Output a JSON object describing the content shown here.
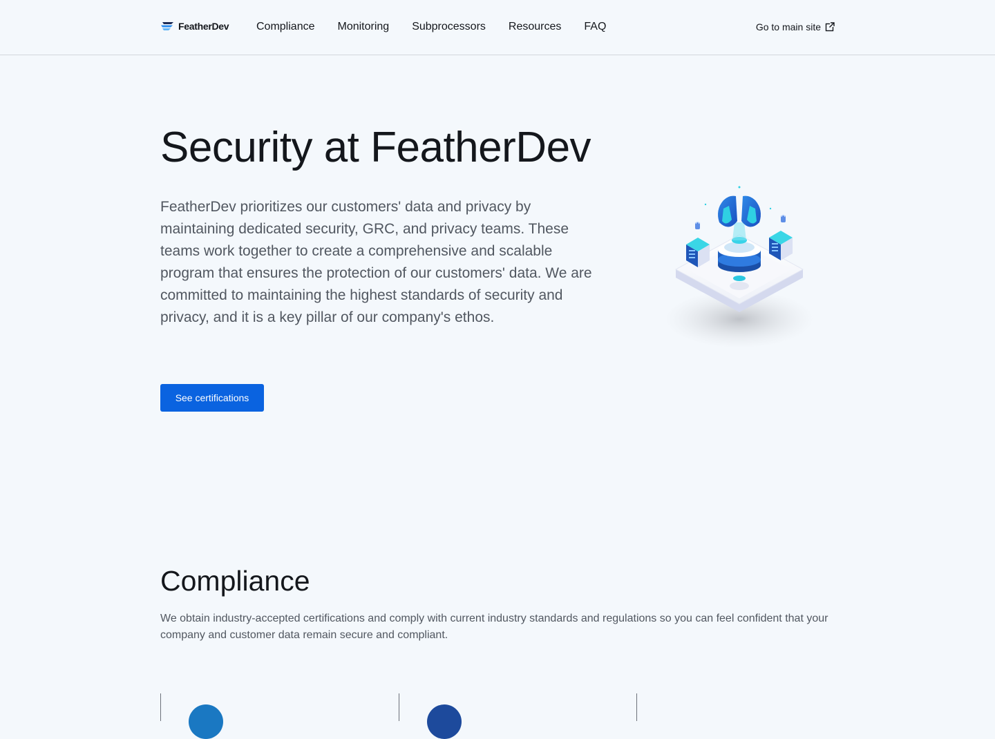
{
  "header": {
    "logo_text": "FeatherDev",
    "nav": [
      {
        "label": "Compliance"
      },
      {
        "label": "Monitoring"
      },
      {
        "label": "Subprocessors"
      },
      {
        "label": "Resources"
      },
      {
        "label": "FAQ"
      }
    ],
    "main_site_label": "Go to main site",
    "main_site_icon": "external-link-icon"
  },
  "hero": {
    "title": "Security at FeatherDev",
    "description": "FeatherDev prioritizes our customers' data and privacy by maintaining dedicated security, GRC, and privacy teams. These teams work together to create a comprehensive and scalable program that ensures the protection of our customers' data. We are committed to maintaining the highest standards of security and privacy, and it is a key pillar of our company's ethos.",
    "cta_label": "See certifications",
    "illustration_icon": "security-platform-illustration"
  },
  "compliance": {
    "title": "Compliance",
    "description": "We obtain industry-accepted certifications and comply with current industry standards and regulations so you can feel confident that your company and customer data remain secure and compliant.",
    "badge_colors": [
      "#1a78c2",
      "#1d4a9c"
    ]
  },
  "colors": {
    "accent": "#0a63e0",
    "page_background": "#f4f8fc",
    "body_text": "#515760"
  }
}
